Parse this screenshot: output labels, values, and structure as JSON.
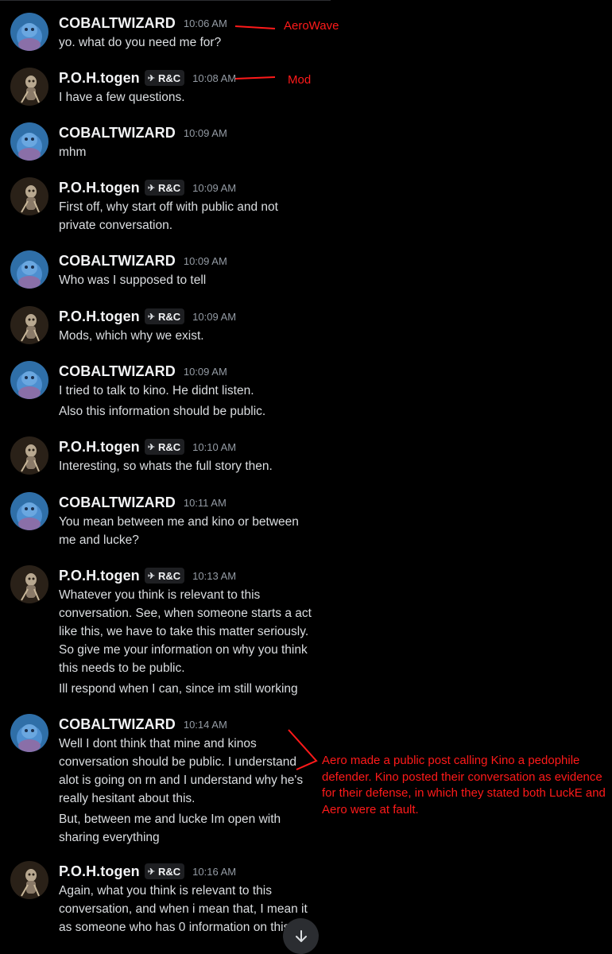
{
  "users": {
    "cobalt": {
      "name": "COBALTWIZARD"
    },
    "poh": {
      "name": "P.O.H.togen",
      "tag": "R&C"
    }
  },
  "messages": [
    {
      "time": "10:06 AM",
      "lines": [
        "yo. what do you need me for?"
      ]
    },
    {
      "time": "10:08 AM",
      "lines": [
        "I have a few questions."
      ]
    },
    {
      "time": "10:09 AM",
      "lines": [
        "mhm"
      ]
    },
    {
      "time": "10:09 AM",
      "lines": [
        "First off, why start off with public and not private  conversation."
      ]
    },
    {
      "time": "10:09 AM",
      "lines": [
        "Who was I supposed to tell"
      ]
    },
    {
      "time": "10:09 AM",
      "lines": [
        "Mods, which why we exist."
      ]
    },
    {
      "time": "10:09 AM",
      "lines": [
        "I tried to talk to kino. He didnt listen.",
        "Also this information should be public."
      ]
    },
    {
      "time": "10:10 AM",
      "lines": [
        "Interesting, so whats the full story then."
      ]
    },
    {
      "time": "10:11 AM",
      "lines": [
        "You mean between me and kino or between me and lucke?"
      ]
    },
    {
      "time": "10:13 AM",
      "lines": [
        "Whatever you think is relevant to this conversation.  See, when someone starts a act like this, we have to take this matter seriously. So give me your information on why you think this needs to be public.",
        "Ill respond when I can, since im still working"
      ]
    },
    {
      "time": "10:14 AM",
      "lines": [
        "Well I dont think that mine and kinos conversation should be public. I understand alot is going on rn and I understand why he's really hesitant about this.",
        "But, between me and lucke Im open with sharing everything"
      ]
    },
    {
      "time": "10:16 AM",
      "lines": [
        "Again, what you think is relevant to this conversation, and when i mean that, I mean it as someone who has 0 information on this"
      ]
    }
  ],
  "annotations": {
    "aerowave": "AeroWave",
    "mod": "Mod",
    "note": "Aero made a public post calling Kino a pedophile defender. Kino posted their conversation as evidence for their defense, in which they stated both LuckE and Aero were at fault."
  },
  "colors": {
    "annotation": "#ff1a1a",
    "background": "#000000",
    "timestamp": "#949ba4"
  },
  "icons": {
    "scroll": "arrow-down-icon",
    "tag": "pin-icon"
  }
}
